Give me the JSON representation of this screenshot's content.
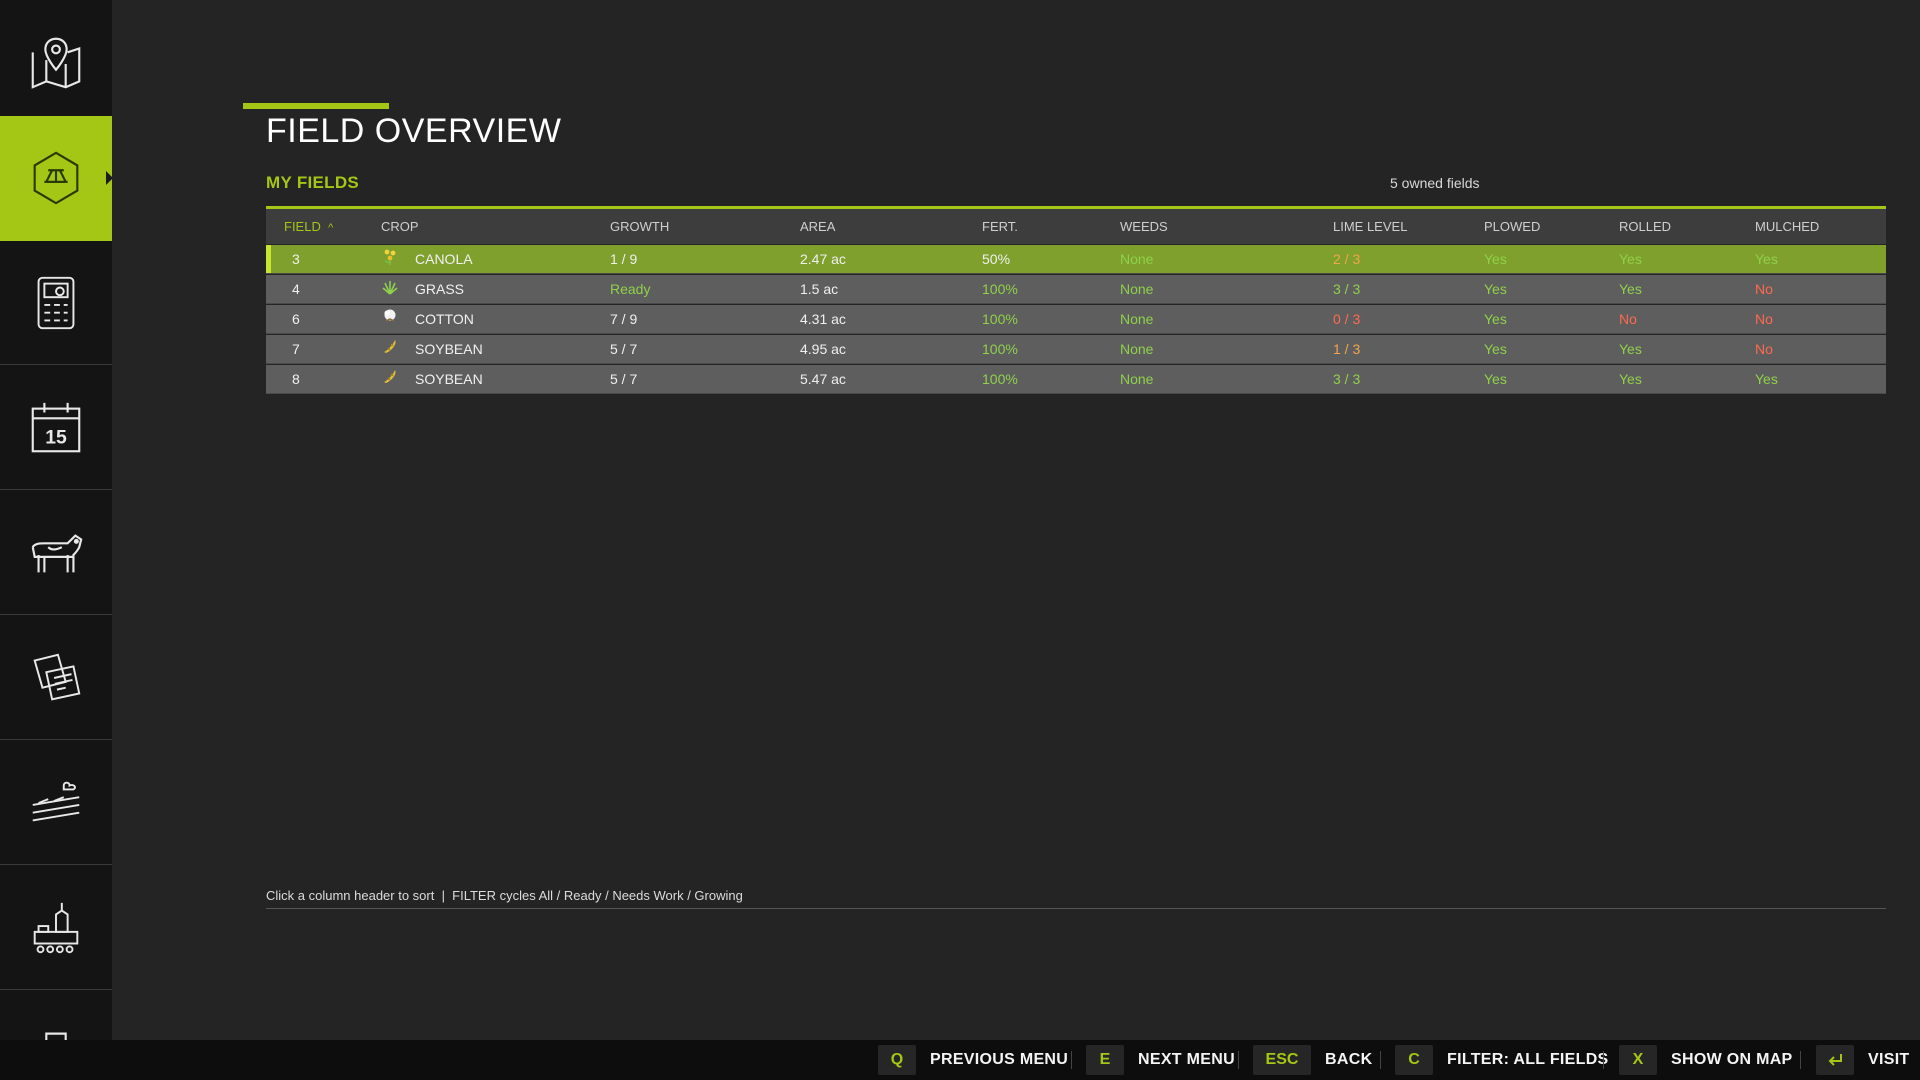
{
  "sidebar": {
    "items": [
      {
        "icon": "map-icon"
      },
      {
        "icon": "field-hexagon-icon",
        "active": true
      },
      {
        "icon": "finance-calculator-icon"
      },
      {
        "icon": "calendar-icon",
        "day": "15"
      },
      {
        "icon": "cow-icon"
      },
      {
        "icon": "contracts-icon"
      },
      {
        "icon": "production-icon"
      },
      {
        "icon": "factory-icon"
      },
      {
        "icon": "vehicle-icon"
      }
    ]
  },
  "header": {
    "title": "FIELD OVERVIEW",
    "section": "MY FIELDS",
    "owned_count": "5 owned fields"
  },
  "table": {
    "columns": {
      "field": "FIELD",
      "sort_indicator": "^",
      "crop": "CROP",
      "growth": "GROWTH",
      "area": "AREA",
      "fert": "FERT.",
      "weeds": "WEEDS",
      "lime": "LIME LEVEL",
      "plowed": "PLOWED",
      "rolled": "ROLLED",
      "mulched": "MULCHED"
    },
    "rows": [
      {
        "field": "3",
        "crop": "CANOLA",
        "crop_icon": "canola-icon",
        "growth": "1 / 9",
        "area": "2.47 ac",
        "fert": "50%",
        "weeds": "None",
        "lime": "2 / 3",
        "plowed": "Yes",
        "rolled": "Yes",
        "mulched": "Yes",
        "selected": true
      },
      {
        "field": "4",
        "crop": "GRASS",
        "crop_icon": "grass-icon",
        "growth": "Ready",
        "area": "1.5 ac",
        "fert": "100%",
        "weeds": "None",
        "lime": "3 / 3",
        "plowed": "Yes",
        "rolled": "Yes",
        "mulched": "No"
      },
      {
        "field": "6",
        "crop": "COTTON",
        "crop_icon": "cotton-icon",
        "growth": "7 / 9",
        "area": "4.31 ac",
        "fert": "100%",
        "weeds": "None",
        "lime": "0 / 3",
        "plowed": "Yes",
        "rolled": "No",
        "mulched": "No"
      },
      {
        "field": "7",
        "crop": "SOYBEAN",
        "crop_icon": "soybean-icon",
        "growth": "5 / 7",
        "area": "4.95 ac",
        "fert": "100%",
        "weeds": "None",
        "lime": "1 / 3",
        "plowed": "Yes",
        "rolled": "Yes",
        "mulched": "No"
      },
      {
        "field": "8",
        "crop": "SOYBEAN",
        "crop_icon": "soybean-icon",
        "growth": "5 / 7",
        "area": "5.47 ac",
        "fert": "100%",
        "weeds": "None",
        "lime": "3 / 3",
        "plowed": "Yes",
        "rolled": "Yes",
        "mulched": "Yes"
      }
    ]
  },
  "hint": "Click a column header to sort  |  FILTER cycles All / Ready / Needs Work / Growing",
  "actions": [
    {
      "key": "Q",
      "label": "PREVIOUS MENU"
    },
    {
      "key": "E",
      "label": "NEXT MENU"
    },
    {
      "key": "ESC",
      "label": "BACK"
    },
    {
      "key": "C",
      "label": "FILTER: ALL FIELDS"
    },
    {
      "key": "X",
      "label": "SHOW ON MAP"
    },
    {
      "key": "enter-icon",
      "label": "VISIT"
    }
  ],
  "colors": {
    "accent": "#a4c615",
    "good": "#8fd14a",
    "warn": "#f0a64a",
    "bad": "#ff6a50",
    "selected_row": "#7fa02d"
  }
}
